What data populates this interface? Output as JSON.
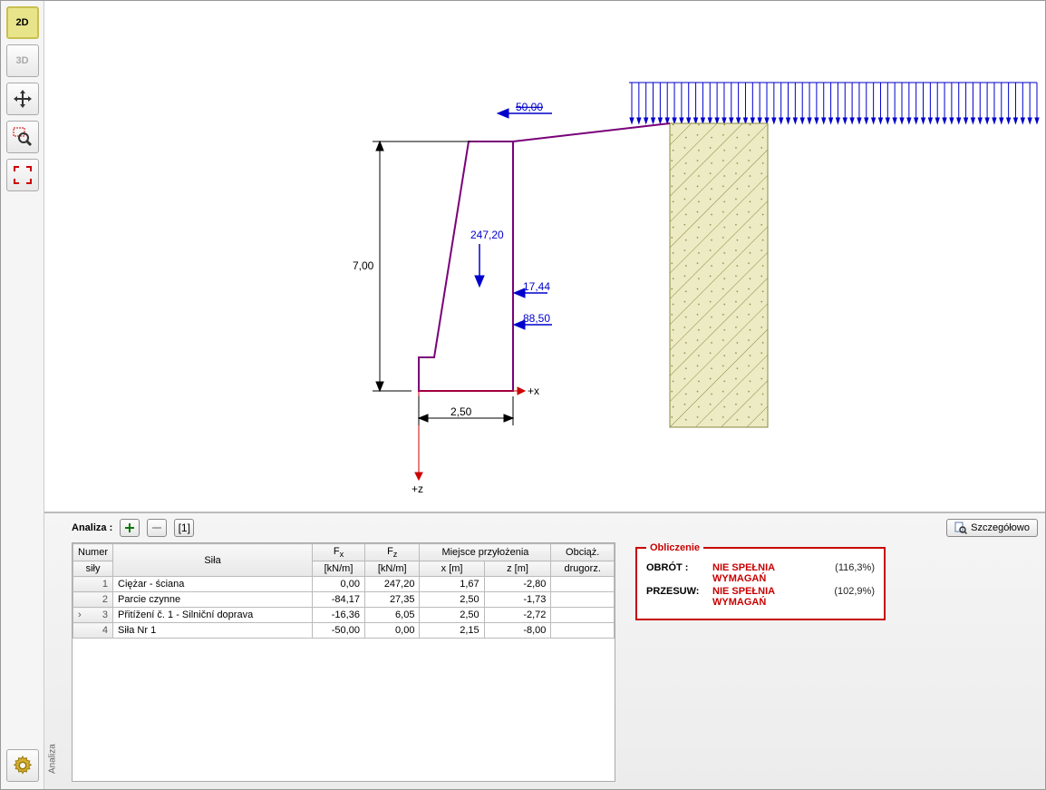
{
  "toolbar": {
    "btn_2d": "2D",
    "btn_3d": "3D"
  },
  "canvas": {
    "load_top": "50,00",
    "force_main": "247,20",
    "force_h1": "17,44",
    "force_h2": "88,50",
    "dim_v": "7,00",
    "dim_h": "2,50",
    "axis_x": "+x",
    "axis_z": "+z"
  },
  "panel": {
    "title": "Analiza :",
    "page": "[1]",
    "tab": "Analiza",
    "detail_btn": "Szczegółowo"
  },
  "table": {
    "headers": {
      "numer1": "Numer",
      "numer2": "siły",
      "sila": "Siła",
      "fx1": "F",
      "fx_sub": "x",
      "fx2": "[kN/m]",
      "fz1": "F",
      "fz_sub": "z",
      "fz2": "[kN/m]",
      "miejsce": "Miejsce przyłożenia",
      "xm": "x [m]",
      "zm": "z [m]",
      "obc1": "Obciąż.",
      "obc2": "drugorz."
    },
    "rows": [
      {
        "idx": "1",
        "sel": false,
        "name": "Ciężar - ściana",
        "fx": "0,00",
        "fz": "247,20",
        "x": "1,67",
        "z": "-2,80",
        "o": ""
      },
      {
        "idx": "2",
        "sel": false,
        "name": "Parcie czynne",
        "fx": "-84,17",
        "fz": "27,35",
        "x": "2,50",
        "z": "-1,73",
        "o": ""
      },
      {
        "idx": "3",
        "sel": true,
        "name": "Přitížení č. 1 - Silniční doprava",
        "fx": "-16,36",
        "fz": "6,05",
        "x": "2,50",
        "z": "-2,72",
        "o": ""
      },
      {
        "idx": "4",
        "sel": false,
        "name": "Siła Nr 1",
        "fx": "-50,00",
        "fz": "0,00",
        "x": "2,15",
        "z": "-8,00",
        "o": ""
      }
    ]
  },
  "results": {
    "title": "Obliczenie",
    "rows": [
      {
        "label": "OBRÓT :",
        "status": "NIE SPEŁNIA WYMAGAŃ",
        "pct": "(116,3%)"
      },
      {
        "label": "PRZESUW:",
        "status": "NIE SPEŁNIA WYMAGAŃ",
        "pct": "(102,9%)"
      }
    ]
  },
  "chart_data": {
    "type": "diagram",
    "description": "Retaining wall cross-section with applied forces",
    "dimensions": {
      "height_m": 7.0,
      "base_width_m": 2.5
    },
    "distributed_load_top_kNm": 50.0,
    "forces": [
      {
        "name": "self-weight",
        "Fz_kNm": 247.2
      },
      {
        "name": "horizontal-1",
        "F_kNm": 17.44
      },
      {
        "name": "horizontal-2",
        "F_kNm": 88.5
      }
    ],
    "axes": {
      "x": "+x",
      "z": "+z"
    }
  }
}
